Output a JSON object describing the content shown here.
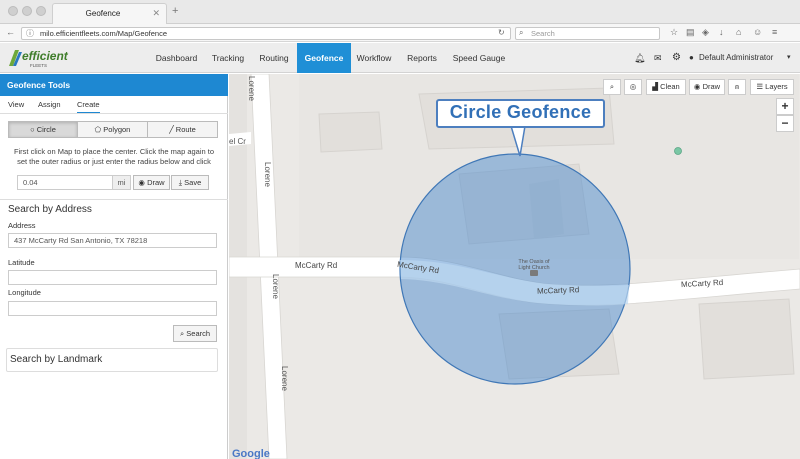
{
  "browser": {
    "tab_title": "Geofence",
    "url": "milo.efficientfleets.com/Map/Geofence",
    "search_placeholder": "Search"
  },
  "nav": {
    "logo_text": "efficient",
    "logo_sub": "FLEETS",
    "items": [
      "Dashboard",
      "Tracking",
      "Routing",
      "Geofence",
      "Workflow",
      "Reports",
      "Speed Gauge"
    ],
    "active": "Geofence",
    "user": "Default Administrator"
  },
  "panel": {
    "title": "Geofence Tools",
    "tabs": [
      "View",
      "Assign",
      "Create"
    ],
    "active_tab": "Create",
    "shapes": [
      "Circle",
      "Polygon",
      "Route"
    ],
    "active_shape": "Circle",
    "instructions": "First click on Map to place the center. Click the map again to set the outer radius or just enter the radius below and click",
    "radius_value": "0.04",
    "radius_unit": "mi",
    "draw_label": "Draw",
    "save_label": "Save",
    "search_address_title": "Search by Address",
    "address_label": "Address",
    "address_value": "437 McCarty Rd San Antonio, TX 78218",
    "latitude_label": "Latitude",
    "latitude_value": "",
    "longitude_label": "Longitude",
    "longitude_value": "",
    "search_label": "Search",
    "landmark_title": "Search by Landmark"
  },
  "map": {
    "tools": [
      "Clean",
      "Draw",
      "Layers"
    ],
    "callout": "Circle Geofence",
    "roads": [
      "McCarty Rd",
      "McCarty Rd",
      "McCarty Rd",
      "McCarty Rd",
      "Lorene",
      "Lorene",
      "Lorene",
      "Lorene",
      "el Cr"
    ],
    "poi": "The Oasis of Light Church",
    "attribution": "Google",
    "geofence_color": "#4d8ccd"
  }
}
